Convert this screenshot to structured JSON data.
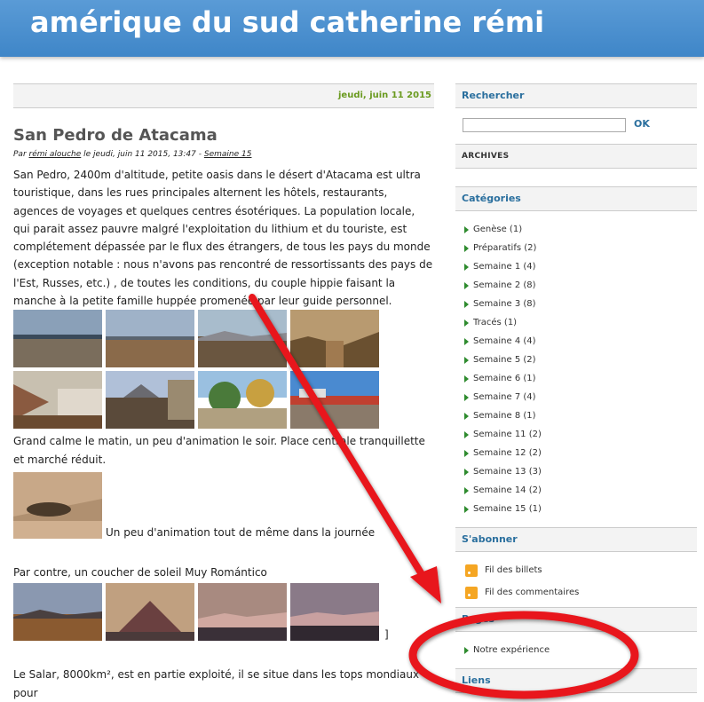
{
  "header": {
    "title": "amérique du sud catherine rémi"
  },
  "post": {
    "date": "jeudi, juin 11 2015",
    "title": "San Pedro de Atacama",
    "meta_prefix": "Par ",
    "author": "rémi alouche",
    "meta_middle": " le jeudi, juin 11 2015, 13:47 - ",
    "category": "Semaine 15",
    "para1": "San Pedro, 2400m d'altitude, petite oasis dans le désert d'Atacama est ultra touristique, dans les rues principales alternent les hôtels, restaurants, agences de voyages et quelques centres ésotériques. La population locale, qui parait assez pauvre malgré l'exploitation du lithium et du touriste, est complétement dépassée par le flux des étrangers, de tous les pays du monde (exception notable : nous n'avons pas rencontré de ressortissants des pays de l'Est, Russes, etc.) , de toutes les conditions, du couple hippie faisant la manche à la petite famille huppée promenée par leur guide personnel.",
    "para2": "Grand calme le matin, un peu d'animation le soir. Place centrale tranquillette et marché réduit.",
    "caption_single": "Un peu d'animation tout de même dans la journée",
    "para3": "Par contre, un coucher de soleil Muy Romántico",
    "bracket": "]",
    "para4": "Le Salar, 8000km², est en partie exploité, il se situe dans les tops mondiaux pour"
  },
  "sidebar": {
    "search_title": "Rechercher",
    "search_value": "",
    "ok_label": "OK",
    "archives_title": "ARCHIVES",
    "categories_title": "Catégories",
    "categories": [
      "Genèse (1)",
      "Préparatifs (2)",
      "Semaine 1 (4)",
      "Semaine 2 (8)",
      "Semaine 3 (8)",
      "Tracés (1)",
      "Semaine 4 (4)",
      "Semaine 5 (2)",
      "Semaine 6 (1)",
      "Semaine 7 (4)",
      "Semaine 8 (1)",
      "Semaine 11 (2)",
      "Semaine 12 (2)",
      "Semaine 13 (3)",
      "Semaine 14 (2)",
      "Semaine 15 (1)"
    ],
    "subscribe_title": "S'abonner",
    "feeds": [
      "Fil des billets",
      "Fil des commentaires"
    ],
    "pages_title": "Pages",
    "pages": [
      "Notre expérience"
    ],
    "links_title": "Liens"
  },
  "colors": {
    "header_blue": "#4a90d0",
    "accent_green": "#6a9a1f",
    "sidebar_title": "#2a6f9e",
    "annotation_red": "#e8141b"
  },
  "icons": {
    "bullet": "triangle-bullet-icon",
    "feed": "rss-icon"
  }
}
